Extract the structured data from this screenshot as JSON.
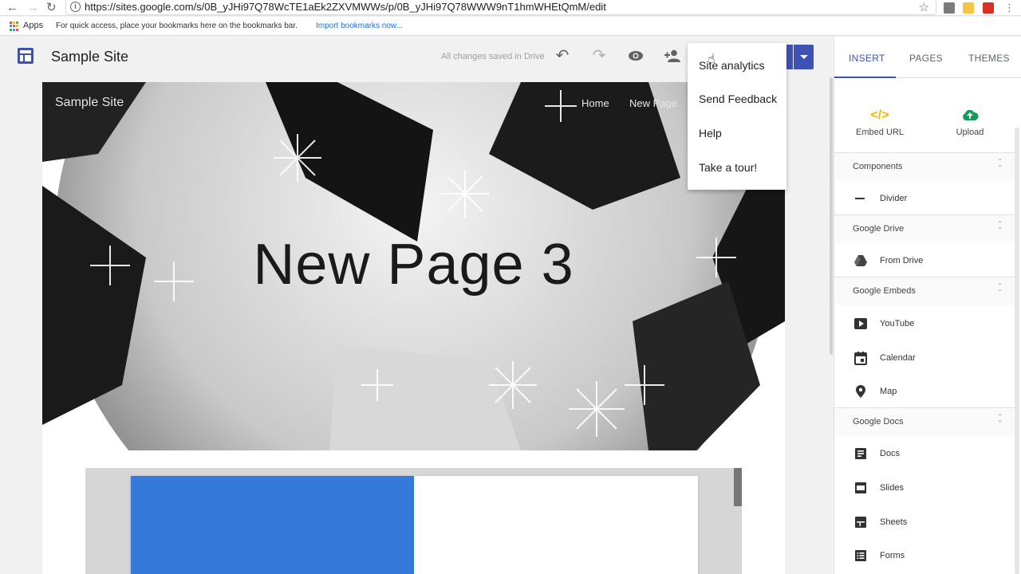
{
  "browser": {
    "url": "https://sites.google.com/s/0B_yJHi97Q78WcTE1aEk2ZXVMWWs/p/0B_yJHi97Q78WWW9nT1hmWHEtQmM/edit",
    "bookmarks_apps": "Apps",
    "bookmarks_hint": "For quick access, place your bookmarks here on the bookmarks bar.",
    "bookmarks_import": "Import bookmarks now..."
  },
  "header": {
    "site_title": "Sample Site",
    "save_status": "All changes saved in Drive"
  },
  "hero": {
    "site_name": "Sample Site",
    "nav_home": "Home",
    "nav_newpage": "New Page",
    "title": "New Page 3"
  },
  "menu": {
    "items": [
      "Site analytics",
      "Send Feedback",
      "Help",
      "Take a tour!"
    ]
  },
  "panel": {
    "tabs": [
      "INSERT",
      "PAGES",
      "THEMES"
    ],
    "embed_url": "Embed URL",
    "upload": "Upload",
    "sections": [
      {
        "title": "Components",
        "items": [
          "Divider"
        ]
      },
      {
        "title": "Google Drive",
        "items": [
          "From Drive"
        ]
      },
      {
        "title": "Google Embeds",
        "items": [
          "YouTube",
          "Calendar",
          "Map"
        ]
      },
      {
        "title": "Google Docs",
        "items": [
          "Docs",
          "Slides",
          "Sheets",
          "Forms"
        ]
      }
    ]
  },
  "colors": {
    "accent": "#3f51b5",
    "blue_block": "#3579d9",
    "embed_icon": "#f4b400",
    "upload_icon": "#0f9d58"
  }
}
